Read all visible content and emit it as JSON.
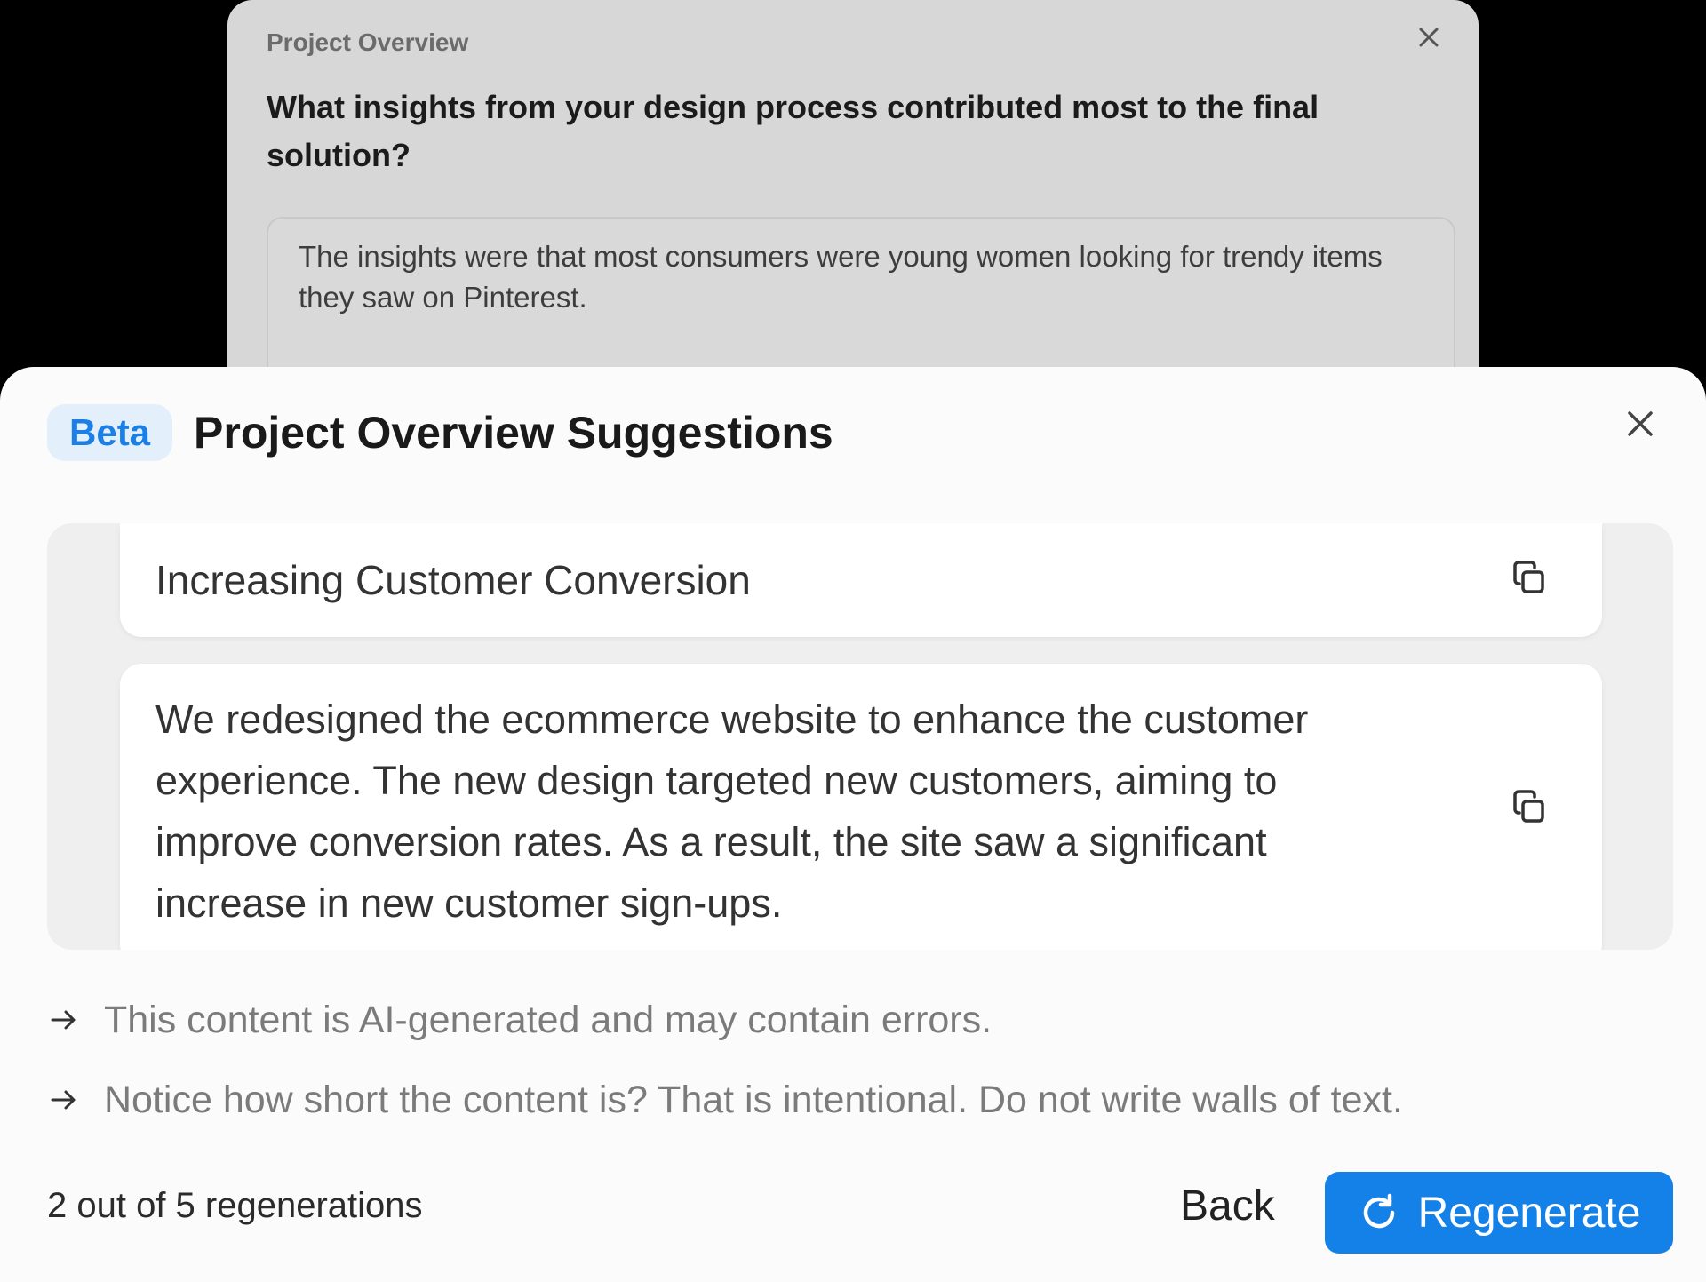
{
  "background_dialog": {
    "title": "Project Overview",
    "question": "What insights from your design process contributed most to the final solution?",
    "answer": "The insights were that most consumers were young women looking for trendy items they saw on Pinterest.",
    "close_icon": "close-icon"
  },
  "panel": {
    "badge": "Beta",
    "title": "Project Overview Suggestions",
    "close_icon": "close-icon",
    "suggestions": [
      {
        "text": "Increasing Customer Conversion",
        "icon": "copy-icon"
      },
      {
        "text": "We redesigned the ecommerce website to enhance the customer experience. The new design targeted new customers, aiming to improve conversion rates. As a result, the site saw a significant increase in new customer sign-ups.",
        "icon": "copy-icon"
      }
    ],
    "notes": [
      "This content is AI-generated and may contain errors.",
      "Notice how short the content is? That is intentional. Do not write walls of text."
    ],
    "regeneration_count": "2 out of 5 regenerations",
    "back_label": "Back",
    "regenerate_label": "Regenerate"
  },
  "colors": {
    "accent": "#1481e8",
    "badge_bg": "#e3effb",
    "badge_text": "#1b7fe6"
  }
}
